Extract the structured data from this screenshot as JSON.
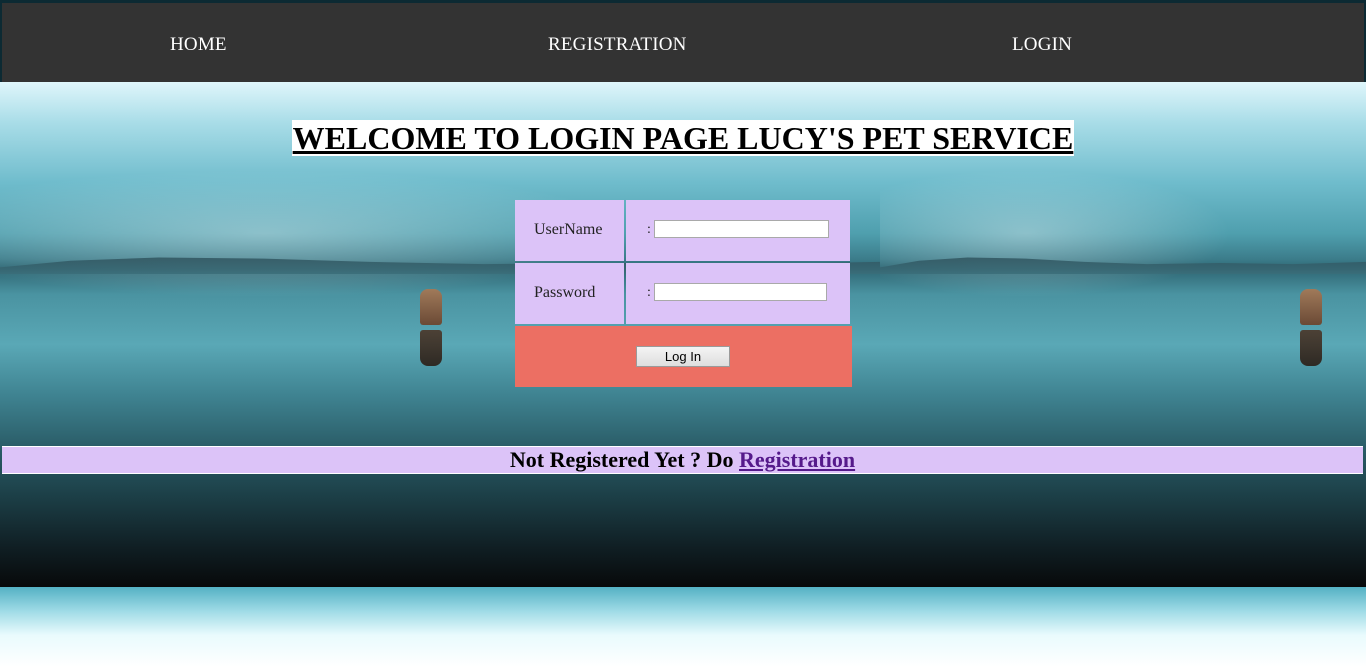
{
  "nav": {
    "home": "HOME",
    "registration": "REGISTRATION",
    "login": "LOGIN"
  },
  "page_title": "WELCOME TO LOGIN PAGE LUCY'S PET SERVICE",
  "form": {
    "username_label": "UserName",
    "username_colon": ":",
    "username_value": "",
    "password_label": "Password",
    "password_colon": ":",
    "password_value": "",
    "submit_label": "Log In"
  },
  "register_prompt": {
    "text": "Not Registered Yet ? Do ",
    "link": "Registration"
  },
  "colors": {
    "nav_bg": "#333333",
    "form_cell": "#dcc3f8",
    "button_row": "#ec6f63",
    "link": "#551a8b"
  }
}
